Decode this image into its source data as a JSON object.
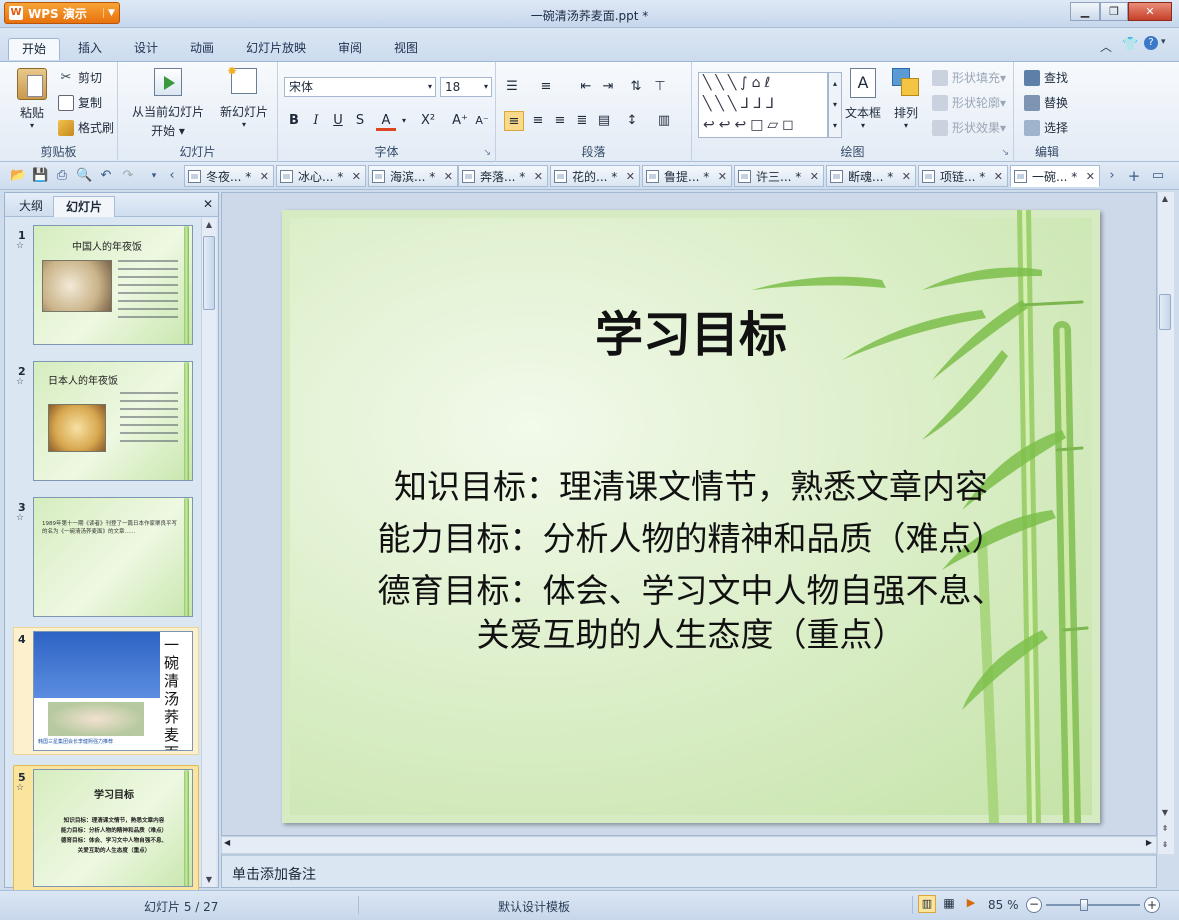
{
  "app": {
    "name": "WPS 演示",
    "document_title": "一碗清汤荞麦面.ppt *"
  },
  "menu_tabs": [
    "开始",
    "插入",
    "设计",
    "动画",
    "幻灯片放映",
    "审阅",
    "视图"
  ],
  "ribbon": {
    "clipboard": {
      "paste": "粘贴",
      "cut": "剪切",
      "copy": "复制",
      "format_painter": "格式刷",
      "label": "剪贴板"
    },
    "slides": {
      "from_current": "从当前幻灯片",
      "start": "开始",
      "new_slide": "新幻灯片",
      "label": "幻灯片"
    },
    "font": {
      "name": "宋体",
      "size": "18",
      "label": "字体"
    },
    "paragraph": {
      "label": "段落"
    },
    "drawing": {
      "textbox": "文本框",
      "arrange": "排列",
      "shape_fill": "形状填充",
      "shape_outline": "形状轮廓",
      "shape_effect": "形状效果",
      "label": "绘图"
    },
    "editing": {
      "find": "查找",
      "replace": "替换",
      "select": "选择",
      "label": "编辑"
    }
  },
  "doc_tabs": [
    "冬夜... *",
    "冰心... *",
    "海滨... *",
    "奔落... *",
    "花的... *",
    "鲁提... *",
    "许三... *",
    "断魂... *",
    "项链... *",
    "一碗... *"
  ],
  "left_panel": {
    "tab_outline": "大纲",
    "tab_slides": "幻灯片",
    "thumbs": [
      {
        "num": "1",
        "title": "中国人的年夜饭"
      },
      {
        "num": "2",
        "title": "日本人的年夜饭"
      },
      {
        "num": "3",
        "text": "1989年第十一期《读者》刊登了一篇日本作家栗良平写的名为《一碗清汤荞麦面》的文章……"
      },
      {
        "num": "4",
        "text": "一碗清汤荞麦面",
        "caption": "韩国三星集团会长李健熙强力推荐"
      },
      {
        "num": "5",
        "title": "学习目标",
        "lines": [
          "知识目标：理清课文情节，熟悉文章内容",
          "能力目标：分析人物的精神和品质（难点）",
          "德育目标：体会、学习文中人物自强不息、",
          "关爱互助的人生态度（重点）"
        ]
      }
    ]
  },
  "slide": {
    "title": "学习目标",
    "lines": [
      "知识目标：理清课文情节，熟悉文章内容",
      "能力目标：分析人物的精神和品质（难点）",
      "德育目标：体会、学习文中人物自强不息、",
      "关爱互助的人生态度（重点）"
    ]
  },
  "notes_placeholder": "单击添加备注",
  "status": {
    "slide_counter": "幻灯片 5 / 27",
    "template": "默认设计模板",
    "zoom": "85 %"
  }
}
